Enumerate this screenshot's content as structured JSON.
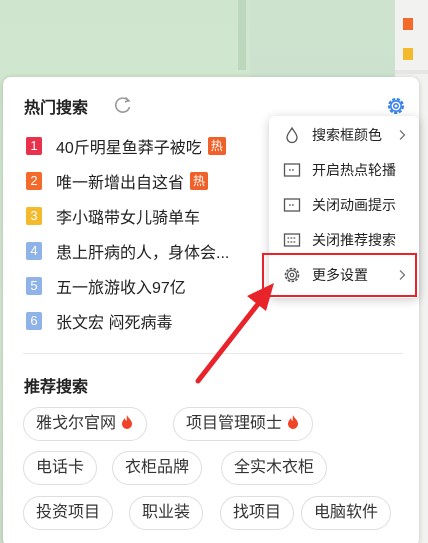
{
  "hot": {
    "title": "热门搜索",
    "items": [
      {
        "rank": "1",
        "text": "40斤明星鱼莽子被吃",
        "hot": true,
        "color": "#e8324b"
      },
      {
        "rank": "2",
        "text": "唯一新增出自这省",
        "hot": true,
        "color": "#f36a2a"
      },
      {
        "rank": "3",
        "text": "李小璐带女儿骑单车",
        "hot": false,
        "color": "#f5b92c"
      },
      {
        "rank": "4",
        "text": "患上肝病的人，身体会...",
        "hot": false,
        "color": "#8fb3e8"
      },
      {
        "rank": "5",
        "text": "五一旅游收入97亿",
        "hot": false,
        "color": "#8fb3e8"
      },
      {
        "rank": "6",
        "text": "张文宏 闷死病毒",
        "hot": false,
        "color": "#8fb3e8"
      }
    ],
    "hot_tag": "热"
  },
  "recommend": {
    "title": "推荐搜索",
    "chips": [
      "雅戈尔官网",
      "项目管理硕士",
      "电话卡",
      "衣柜品牌",
      "全实木衣柜",
      "投资项目",
      "职业装",
      "找项目",
      "电脑软件"
    ]
  },
  "menu": {
    "items": [
      {
        "label": "搜索框颜色",
        "icon": "droplet-icon",
        "has_submenu": true
      },
      {
        "label": "开启热点轮播",
        "icon": "carousel-icon",
        "has_submenu": false
      },
      {
        "label": "关闭动画提示",
        "icon": "animation-icon",
        "has_submenu": false
      },
      {
        "label": "关闭推荐搜索",
        "icon": "list-icon",
        "has_submenu": false
      },
      {
        "label": "更多设置",
        "icon": "gear-icon",
        "has_submenu": true
      }
    ]
  },
  "colors": {
    "accent": "#3a82e8",
    "highlight": "#e8232a",
    "hot_tag": "#f0612a"
  }
}
